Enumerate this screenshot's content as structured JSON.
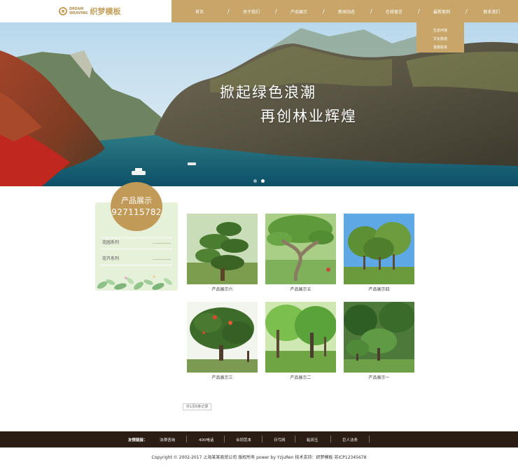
{
  "logo": {
    "en_line1": "DREAM",
    "en_line2": "WEAVING",
    "cn": "织梦模板"
  },
  "nav": {
    "items": [
      "首页",
      "关于我们",
      "产品展示",
      "新闻动态",
      "在线留言",
      "最新案例",
      "联系我们"
    ],
    "separator": "/"
  },
  "dropdown": {
    "items": [
      "生态环境",
      "文化旅游",
      "金融投资"
    ]
  },
  "banner": {
    "slogan_line1": "掀起绿色浪潮",
    "slogan_line2": "再创林业辉煌",
    "slide_count": 2,
    "active_slide": 2
  },
  "sidebar": {
    "title": "产品展示",
    "phone": "927115782",
    "items": [
      "花园系列",
      "花卉系列"
    ]
  },
  "products": [
    {
      "caption": "产品展示六"
    },
    {
      "caption": "产品展示五"
    },
    {
      "caption": "产品展示四"
    },
    {
      "caption": "产品展示三"
    },
    {
      "caption": "产品展示二"
    },
    {
      "caption": "产品展示一"
    }
  ],
  "pager": {
    "text": "共1页6条记录"
  },
  "footer": {
    "links_label": "友情链接：",
    "links": [
      "法律咨询",
      "400电话",
      "合同范本",
      "日弓网",
      "粘田玉",
      "巨人法务"
    ],
    "copyright": "Copyright © 2002-2017 上海某某商贸公司 版权所有 power by YzjuRen  技术支持：织梦模板  苏ICP12345678"
  },
  "colors": {
    "accent": "#c8a66a",
    "footer_bg": "#2b1c14",
    "sidebar_bg": "#e6f1da"
  }
}
